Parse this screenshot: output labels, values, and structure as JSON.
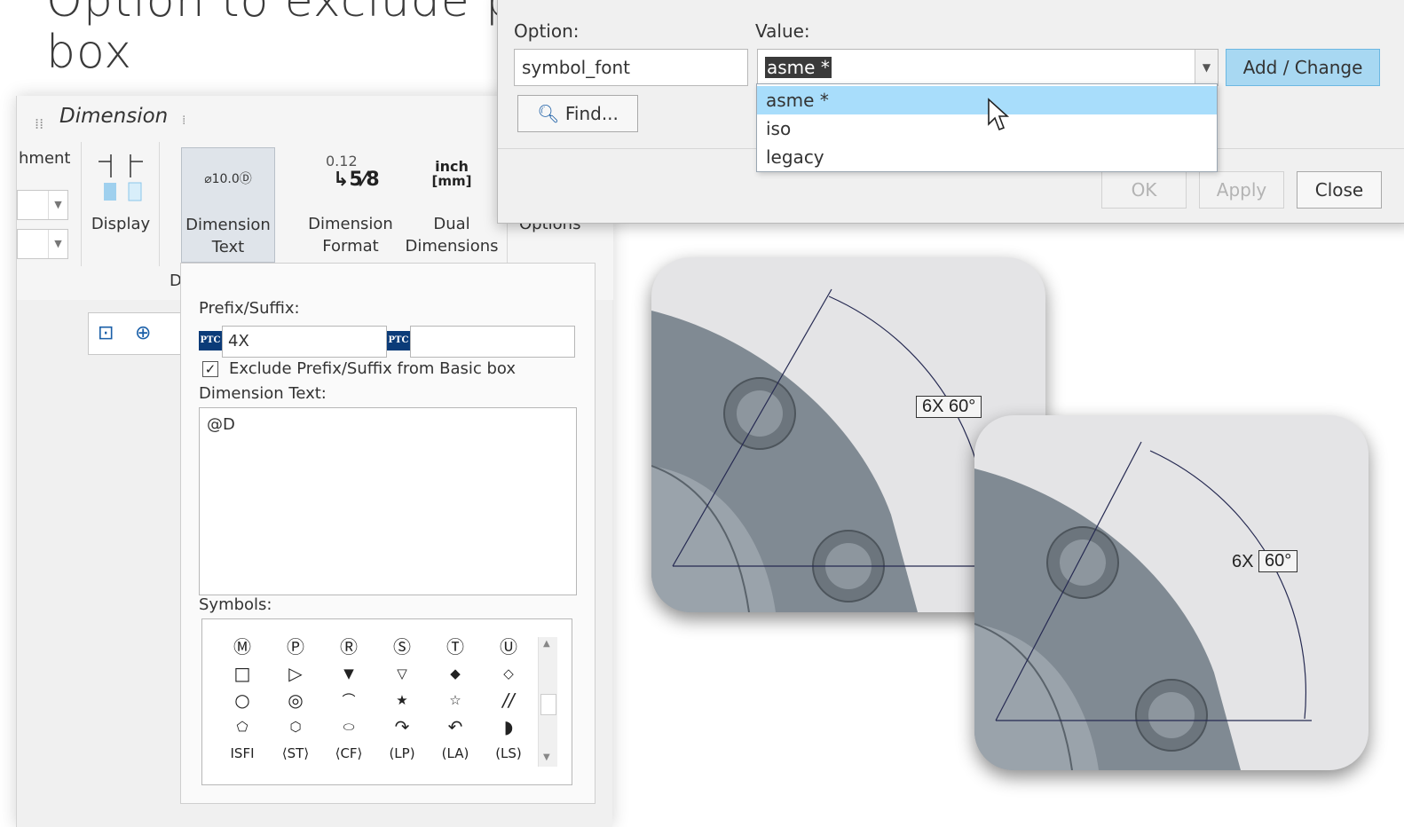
{
  "slide": {
    "title_line1": "Option to exclude prefix/suffix from basic dimension",
    "title_line2": "box"
  },
  "ribbon": {
    "tab_label": "Dimension",
    "attachment_fragment": "hment",
    "display_label": "Display",
    "dim_text_icon": "⌀10.0Ⓓ",
    "dim_text_label_1": "Dimension",
    "dim_text_label_2": "Text",
    "dim_format_icon_top": "0.12",
    "dim_format_icon_bottom": "↳5⁄8",
    "dim_format_label_1": "Dimension",
    "dim_format_label_2": "Format",
    "dual_icon_top": "inch",
    "dual_icon_bottom": "[mm]",
    "dual_label_1": "Dual",
    "dual_label_2": "Dimensions",
    "options_fragment": "Options",
    "group_fragment": "D"
  },
  "panel": {
    "prefix_suffix_label": "Prefix/Suffix:",
    "ptc_badge": "PTC",
    "prefix_value": "4X",
    "suffix_value": "",
    "exclude_checked": true,
    "exclude_label": "Exclude Prefix/Suffix from Basic box",
    "dim_text_label": "Dimension Text:",
    "dim_text_value": "@D",
    "symbols_label": "Symbols:",
    "symbols": [
      [
        "Ⓜ",
        "Ⓟ",
        "Ⓡ",
        "Ⓢ",
        "Ⓣ",
        "Ⓤ"
      ],
      [
        "□",
        "▷",
        "▼",
        "▽",
        "◆",
        "◇"
      ],
      [
        "○",
        "◎",
        "⌒",
        "★",
        "☆",
        "//"
      ],
      [
        "⬠",
        "⬡",
        "⬭",
        "↷",
        "↶",
        "◗"
      ],
      [
        "ⅠSFⅠ",
        "⟨ST⟩",
        "⟨CF⟩",
        "(LP)",
        "(LA)",
        "(LS)"
      ]
    ]
  },
  "options_dialog": {
    "option_label": "Option:",
    "value_label": "Value:",
    "option_value": "symbol_font",
    "value_selected": "asme *",
    "dropdown_items": [
      "asme *",
      "iso",
      "legacy"
    ],
    "highlighted_index": 0,
    "find_label": "Find...",
    "add_change_label": "Add / Change",
    "ok_label": "OK",
    "apply_label": "Apply",
    "close_label": "Close"
  },
  "examples": {
    "card1_label": "6X 60°",
    "card2_prefix": "6X",
    "card2_basic": "60°"
  }
}
